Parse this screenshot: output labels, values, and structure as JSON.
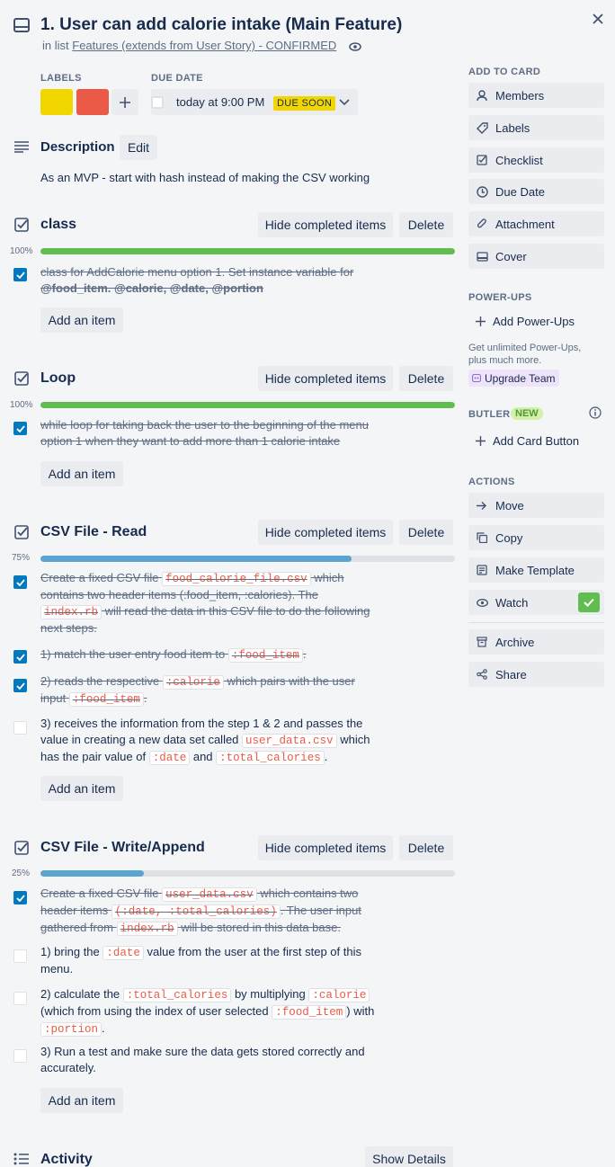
{
  "card": {
    "title": "1. User can add calorie intake (Main Feature)",
    "in_list_prefix": "in list",
    "list_name": "Features (extends from User Story) - CONFIRMED"
  },
  "labels": {
    "heading": "LABELS",
    "colors": [
      "#f2d600",
      "#eb5a46"
    ]
  },
  "due": {
    "heading": "DUE DATE",
    "value": "today at 9:00 PM",
    "badge": "DUE SOON"
  },
  "description": {
    "heading": "Description",
    "edit": "Edit",
    "text": "As an MVP - start with hash instead of making the CSV working"
  },
  "common": {
    "hide_completed": "Hide completed items",
    "delete": "Delete",
    "add_item": "Add an item"
  },
  "checklists": [
    {
      "title": "class",
      "percent": "100%",
      "progress": 1.0,
      "items": [
        {
          "checked": true,
          "text_a": "class for AddCalorie menu option 1. Set instance variable for",
          "text_b": "@food_item. @calorie, @date, @portion"
        }
      ]
    },
    {
      "title": "Loop",
      "percent": "100%",
      "progress": 1.0,
      "items": [
        {
          "checked": true,
          "text_a": "while loop for taking back the user to the beginning of the menu",
          "text_b": "option 1 when they want to add more than 1 calorie intake"
        }
      ]
    },
    {
      "title": "CSV File - Read",
      "percent": "75%",
      "progress": 0.75,
      "items": [
        {
          "checked": true,
          "t1": "Create a fixed CSV file",
          "c1": "food_calorie_file.csv",
          "t2": "which",
          "t3": "contains two header items (:food_item, :calories). The",
          "c2": "index.rb",
          "t4": "will read the data in this CSV file to do the following",
          "t5": "next steps."
        },
        {
          "checked": true,
          "t1": "1) match the user entry food item to",
          "c1": ":food_item",
          "t2": "."
        },
        {
          "checked": true,
          "t1": "2) reads the respective",
          "c1": ":calorie",
          "t2": "which pairs with the user",
          "t3": "input",
          "c2": ":food_item",
          "t4": "."
        },
        {
          "checked": false,
          "t1": "3) receives the information from the step 1 & 2 and passes the",
          "t2": "value in creating a new data set called",
          "c1": "user_data.csv",
          "t3": "which",
          "t4": "has the pair value of",
          "c2": ":date",
          "t5": "and",
          "c3": ":total_calories",
          "t6": "."
        }
      ]
    },
    {
      "title": "CSV File - Write/Append",
      "percent": "25%",
      "progress": 0.25,
      "items": [
        {
          "checked": true,
          "t1": "Create a fixed CSV file",
          "c1": "user_data.csv",
          "t2": "which contains two",
          "t3": "header items",
          "c2": "(:date, :total_calories)",
          "t4": ". The user input",
          "t5": "gathered from",
          "c3": "index.rb",
          "t6": "will be stored in this data base."
        },
        {
          "checked": false,
          "t1": "1) bring the",
          "c1": ":date",
          "t2": "value from the user at the first step of this",
          "t3": "menu."
        },
        {
          "checked": false,
          "t1": "2) calculate the",
          "c1": ":total_calories",
          "t2": "by multiplying",
          "c2": ":calorie",
          "t3": "(which from using the index of user selected",
          "c3": ":food_item",
          "t4": ") with",
          "c4": ":portion",
          "t5": "."
        },
        {
          "checked": false,
          "t1": "3) Run a test and make sure the data gets stored correctly and",
          "t2": "accurately."
        }
      ]
    }
  ],
  "activity": {
    "heading": "Activity",
    "show_details": "Show Details"
  },
  "sidebar": {
    "add_to_card": "ADD TO CARD",
    "add_items": [
      {
        "label": "Members",
        "icon": "person-icon"
      },
      {
        "label": "Labels",
        "icon": "tag-icon"
      },
      {
        "label": "Checklist",
        "icon": "checklist-icon"
      },
      {
        "label": "Due Date",
        "icon": "clock-icon"
      },
      {
        "label": "Attachment",
        "icon": "paperclip-icon"
      },
      {
        "label": "Cover",
        "icon": "cover-icon"
      }
    ],
    "powerups_heading": "POWER-UPS",
    "add_powerups": "Add Power-Ups",
    "powerups_hint_1": "Get unlimited Power-Ups,",
    "powerups_hint_2": "plus much more.",
    "upgrade": "Upgrade Team",
    "butler_heading": "BUTLER",
    "butler_badge": "NEW",
    "add_card_button": "Add Card Button",
    "actions_heading": "ACTIONS",
    "actions": [
      {
        "label": "Move",
        "icon": "arrow-right-icon"
      },
      {
        "label": "Copy",
        "icon": "copy-icon"
      },
      {
        "label": "Make Template",
        "icon": "template-icon"
      },
      {
        "label": "Watch",
        "icon": "eye-icon"
      }
    ],
    "more_actions": [
      {
        "label": "Archive",
        "icon": "archive-icon"
      },
      {
        "label": "Share",
        "icon": "share-icon"
      }
    ]
  },
  "colors": {
    "progress_complete": "#61bd4f",
    "progress_partial": "#5ba4cf",
    "checkbox_checked": "#0079bf"
  }
}
